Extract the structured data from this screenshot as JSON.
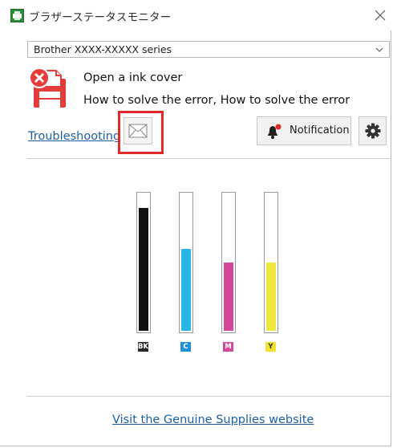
{
  "window": {
    "title": "ブラザーステータスモニター"
  },
  "printer_select": {
    "value": "Brother XXXX-XXXXX series"
  },
  "status": {
    "message": "Open a ink cover",
    "help": "How to solve the error, How to solve the error"
  },
  "links": {
    "troubleshooting": "Troubleshooting",
    "supplies": "Visit the Genuine Supplies website"
  },
  "buttons": {
    "notification": "Notification"
  },
  "ink": {
    "cartridges": [
      {
        "label": "BK",
        "level": 0.9,
        "color": "#111111",
        "label_bg": "#2a2a2a"
      },
      {
        "label": "C",
        "level": 0.6,
        "color": "#29b6e6",
        "label_bg": "#1f8fd6"
      },
      {
        "label": "M",
        "level": 0.5,
        "color": "#d6469a",
        "label_bg": "#d44a9a"
      },
      {
        "label": "Y",
        "level": 0.5,
        "color": "#f0e63c",
        "label_bg": "#f2e230"
      }
    ]
  },
  "colors": {
    "link": "#1a5fa6",
    "highlight": "#e02a2a",
    "error_icon": "#e43b3b"
  },
  "icons": {
    "app": "brother-status-monitor-icon",
    "error_printer": "printer-error-icon",
    "mail": "envelope-icon",
    "bell": "bell-alert-icon",
    "settings": "gear-icon",
    "close": "close-icon",
    "dropdown": "chevron-down-icon"
  }
}
